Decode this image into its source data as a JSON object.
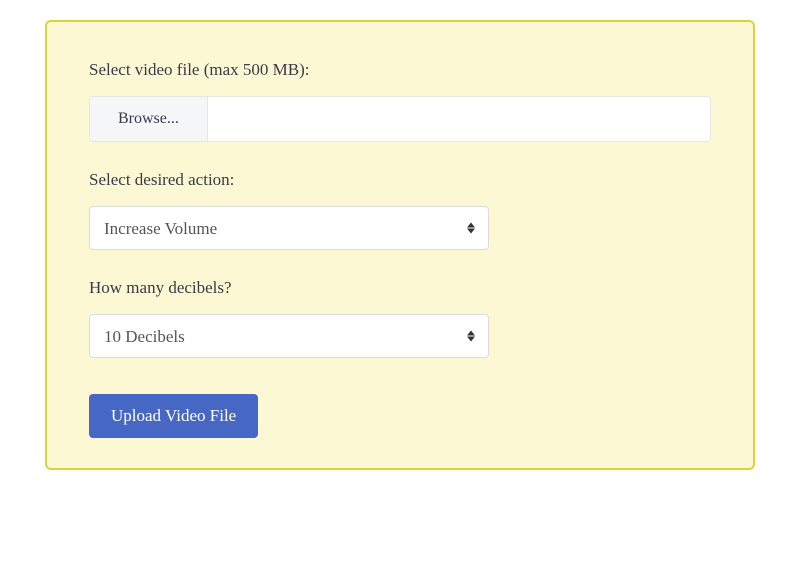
{
  "form": {
    "file_label": "Select video file (max 500 MB):",
    "browse_label": "Browse...",
    "file_selected": "",
    "action_label": "Select desired action:",
    "action_selected": "Increase Volume",
    "decibels_label": "How many decibels?",
    "decibels_selected": "10 Decibels",
    "submit_label": "Upload Video File"
  }
}
